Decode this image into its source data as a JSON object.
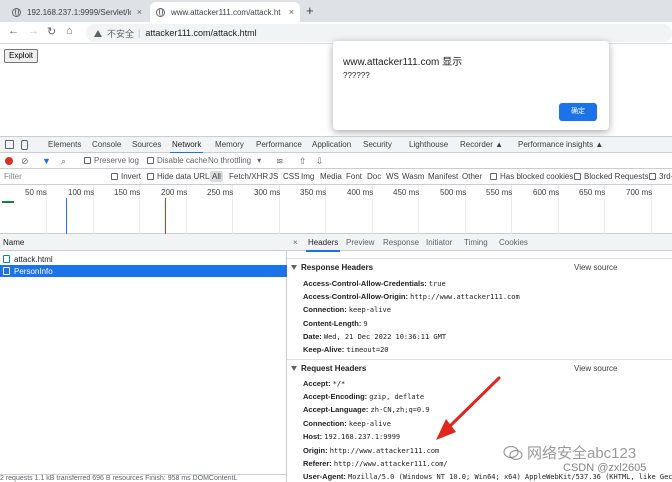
{
  "browser": {
    "tabs": [
      {
        "title": "192.168.237.1:9999/Servlet/lo",
        "close": "×"
      },
      {
        "title": "www.attacker111.com/attack.ht",
        "close": "×"
      }
    ],
    "new_tab": "+",
    "nav": {
      "back": "←",
      "forward": "→",
      "reload": "↻",
      "home": "⌂"
    },
    "address": {
      "security": "不安全",
      "separator": "|",
      "url": "attacker111.com/attack.html"
    }
  },
  "page": {
    "exploit_label": "Exploit",
    "alert": {
      "title": "www.attacker111.com 显示",
      "message": "??????",
      "ok_label": "确定"
    }
  },
  "devtools": {
    "tabs": [
      "Elements",
      "Console",
      "Sources",
      "Network",
      "Memory",
      "Performance",
      "Application",
      "Security",
      "Lighthouse",
      "Recorder ▲",
      "Performance insights ▲"
    ],
    "active_tab": "Network",
    "toolbar": {
      "preserve_log": "Preserve log",
      "disable_cache": "Disable cache",
      "throttling": "No throttling"
    },
    "filter": {
      "placeholder": "Filter",
      "invert": "Invert",
      "hide_data_urls": "Hide data URLs",
      "types": [
        "All",
        "Fetch/XHR",
        "JS",
        "CSS",
        "Img",
        "Media",
        "Font",
        "Doc",
        "WS",
        "Wasm",
        "Manifest",
        "Other"
      ],
      "blocked_cookies": "Has blocked cookies",
      "blocked_requests": "Blocked Requests",
      "third_party": "3rd-"
    },
    "timeline_ticks": [
      "50 ms",
      "100 ms",
      "150 ms",
      "200 ms",
      "250 ms",
      "300 ms",
      "350 ms",
      "400 ms",
      "450 ms",
      "500 ms",
      "550 ms",
      "600 ms",
      "650 ms",
      "700 ms"
    ],
    "requests": {
      "header": "Name",
      "items": [
        "attack.html",
        "PersonInfo"
      ],
      "status": "2 requests   1.1 kB transferred   696 B resources   Finish: 958 ms   DOMContentL"
    },
    "detail": {
      "close": "×",
      "tabs": [
        "Headers",
        "Preview",
        "Response",
        "Initiator",
        "Timing",
        "Cookies"
      ],
      "response_title": "Response Headers",
      "request_title": "Request Headers",
      "view_source": "View source",
      "response_headers": [
        {
          "name": "Access-Control-Allow-Credentials:",
          "value": "true"
        },
        {
          "name": "Access-Control-Allow-Origin:",
          "value": "http://www.attacker111.com"
        },
        {
          "name": "Connection:",
          "value": "keep-alive"
        },
        {
          "name": "Content-Length:",
          "value": "9"
        },
        {
          "name": "Date:",
          "value": "Wed, 21 Dec 2022 10:36:11 GMT"
        },
        {
          "name": "Keep-Alive:",
          "value": "timeout=20"
        }
      ],
      "request_headers": [
        {
          "name": "Accept:",
          "value": "*/*"
        },
        {
          "name": "Accept-Encoding:",
          "value": "gzip, deflate"
        },
        {
          "name": "Accept-Language:",
          "value": "zh-CN,zh;q=0.9"
        },
        {
          "name": "Connection:",
          "value": "keep-alive"
        },
        {
          "name": "Host:",
          "value": "192.168.237.1:9999"
        },
        {
          "name": "Origin:",
          "value": "http://www.attacker111.com"
        },
        {
          "name": "Referer:",
          "value": "http://www.attacker111.com/"
        },
        {
          "name": "User-Agent:",
          "value": "Mozilla/5.0 (Windows NT 10.0; Win64; x64) AppleWebKit/537.36 (KHTML, like Gecko)"
        }
      ]
    }
  },
  "watermark": {
    "line1": "网络安全abc123",
    "line2": "CSDN @zxl2605"
  },
  "colors": {
    "accent": "#1a73e8",
    "record": "#d93025",
    "arrow": "#e0261f"
  }
}
